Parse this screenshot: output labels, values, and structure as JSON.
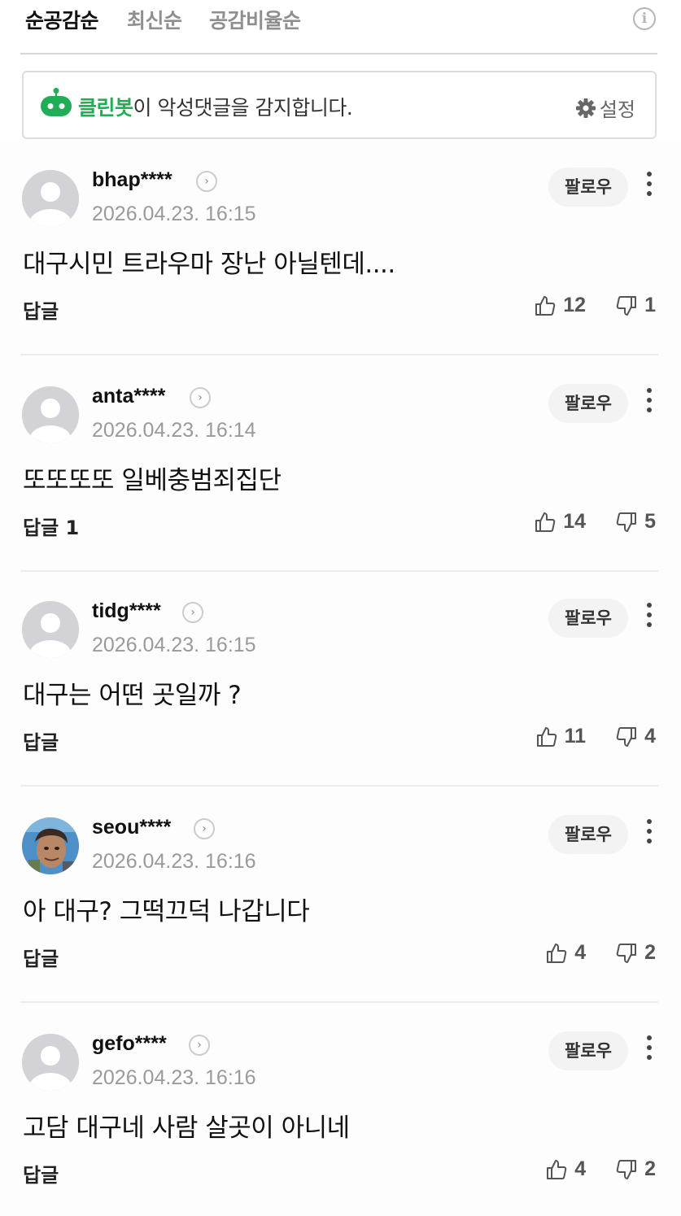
{
  "sort": {
    "tabs": [
      "순공감순",
      "최신순",
      "공감비율순"
    ],
    "active_index": 0,
    "info_icon": "i"
  },
  "cleanbot": {
    "brand": "클린봇",
    "text": "이 악성댓글을 감지합니다.",
    "settings_label": "설정",
    "brand_color": "#1fae55"
  },
  "comments": [
    {
      "username": "bhap****",
      "timestamp": "2026.04.23. 16:15",
      "text": "대구시민 트라우마 장난 아닐텐데....",
      "reply": "답글",
      "likes": "12",
      "dislikes": "1",
      "follow": "팔로우",
      "avatar": "default"
    },
    {
      "username": "anta****",
      "timestamp": "2026.04.23. 16:14",
      "text": "또또또또 일베충범죄집단",
      "reply": "답글 1",
      "likes": "14",
      "dislikes": "5",
      "follow": "팔로우",
      "avatar": "default"
    },
    {
      "username": "tidg****",
      "timestamp": "2026.04.23. 16:15",
      "text": "대구는 어떤 곳일까 ?",
      "reply": "답글",
      "likes": "11",
      "dislikes": "4",
      "follow": "팔로우",
      "avatar": "default"
    },
    {
      "username": "seou****",
      "timestamp": "2026.04.23. 16:16",
      "text": "아 대구? 그떡끄덕 나갑니다",
      "reply": "답글",
      "likes": "4",
      "dislikes": "2",
      "follow": "팔로우",
      "avatar": "photo"
    },
    {
      "username": "gefo****",
      "timestamp": "2026.04.23. 16:16",
      "text": "고담 대구네 사람 살곳이 아니네",
      "reply": "답글",
      "likes": "4",
      "dislikes": "2",
      "follow": "팔로우",
      "avatar": "default"
    }
  ]
}
